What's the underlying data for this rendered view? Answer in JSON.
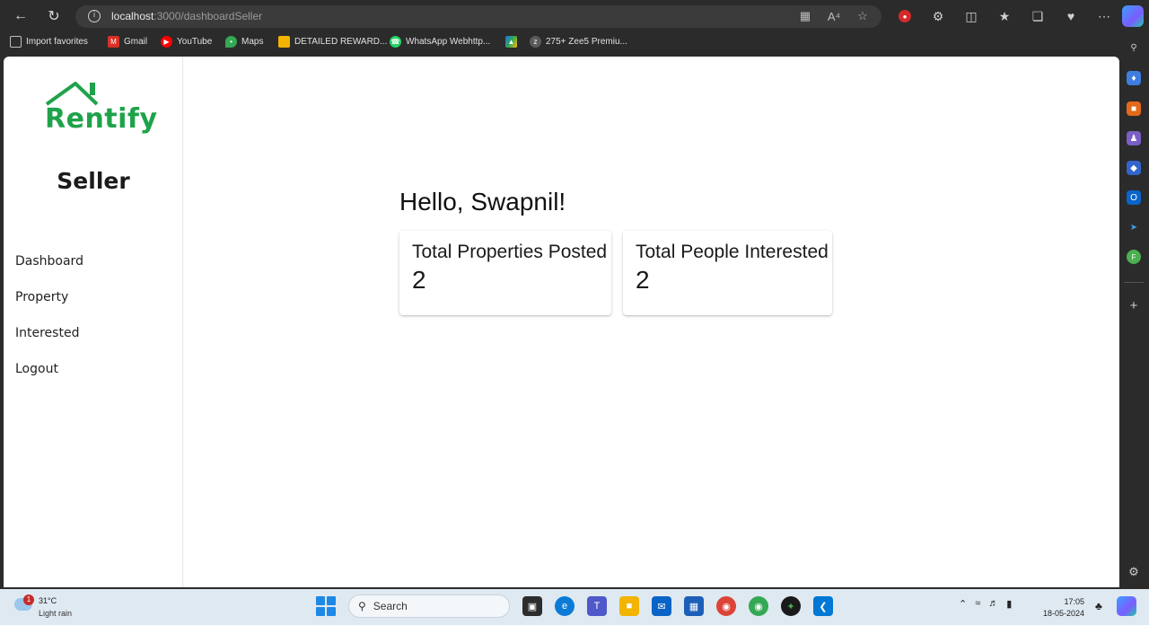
{
  "browser": {
    "url_host": "localhost",
    "url_path": ":3000/dashboardSeller"
  },
  "bookmarks": [
    {
      "label": "Import favorites",
      "icon": "import-icon",
      "color": "#9e9e9e"
    },
    {
      "label": "Gmail",
      "icon": "gmail-icon",
      "color": "#d93025"
    },
    {
      "label": "YouTube",
      "icon": "youtube-icon",
      "color": "#ff0000"
    },
    {
      "label": "Maps",
      "icon": "maps-icon",
      "color": "#34a853"
    },
    {
      "label": "DETAILED REWARD...",
      "icon": "folder-icon",
      "color": "#f2b400"
    },
    {
      "label": "WhatsApp Webhttp...",
      "icon": "whatsapp-icon",
      "color": "#25d366"
    },
    {
      "label": "",
      "icon": "drive-icon",
      "color": "#1a73e8"
    },
    {
      "label": "275+ Zee5 Premiu...",
      "icon": "zee5-icon",
      "color": "#5b5b5b"
    }
  ],
  "app": {
    "brand": "Rentify",
    "brand_color": "#1fa24a",
    "role": "Seller",
    "menu": [
      "Dashboard",
      "Property",
      "Interested",
      "Logout"
    ],
    "greeting": "Hello, Swapnil!",
    "cards": [
      {
        "label": "Total Properties Posted",
        "value": "2"
      },
      {
        "label": "Total People Interested",
        "value": "2"
      }
    ]
  },
  "taskbar": {
    "temperature": "31°C",
    "condition": "Light rain",
    "weather_badge": "1",
    "search_label": "Search",
    "time": "17:05",
    "date": "18-05-2024"
  }
}
